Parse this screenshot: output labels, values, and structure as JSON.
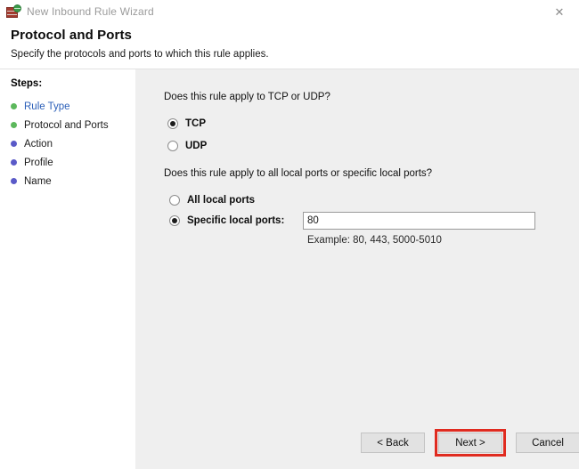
{
  "window": {
    "title": "New Inbound Rule Wizard",
    "app_icon": "firewall-globe-icon",
    "close_label": "✕"
  },
  "header": {
    "title": "Protocol and Ports",
    "subtitle": "Specify the protocols and ports to which this rule applies."
  },
  "sidebar": {
    "label": "Steps:",
    "items": [
      {
        "label": "Rule Type",
        "bullet": "green",
        "is_link": true
      },
      {
        "label": "Protocol and Ports",
        "bullet": "green",
        "is_link": false
      },
      {
        "label": "Action",
        "bullet": "blue",
        "is_link": false
      },
      {
        "label": "Profile",
        "bullet": "blue",
        "is_link": false
      },
      {
        "label": "Name",
        "bullet": "blue",
        "is_link": false
      }
    ]
  },
  "main": {
    "protocol_question": "Does this rule apply to TCP or UDP?",
    "protocol_options": [
      {
        "label": "TCP",
        "selected": true
      },
      {
        "label": "UDP",
        "selected": false
      }
    ],
    "ports_question": "Does this rule apply to all local ports or specific local ports?",
    "ports_options": [
      {
        "label": "All local ports",
        "selected": false
      },
      {
        "label": "Specific local ports:",
        "selected": true
      }
    ],
    "ports_value": "80",
    "ports_hint": "Example: 80, 443, 5000-5010"
  },
  "footer": {
    "back_label": "< Back",
    "next_label": "Next >",
    "cancel_label": "Cancel"
  },
  "colors": {
    "link": "#2b5fb8",
    "bullet_done": "#5cb85c",
    "bullet_pending": "#5a5ac8",
    "highlight": "#e02b20",
    "content_bg": "#efefef"
  }
}
